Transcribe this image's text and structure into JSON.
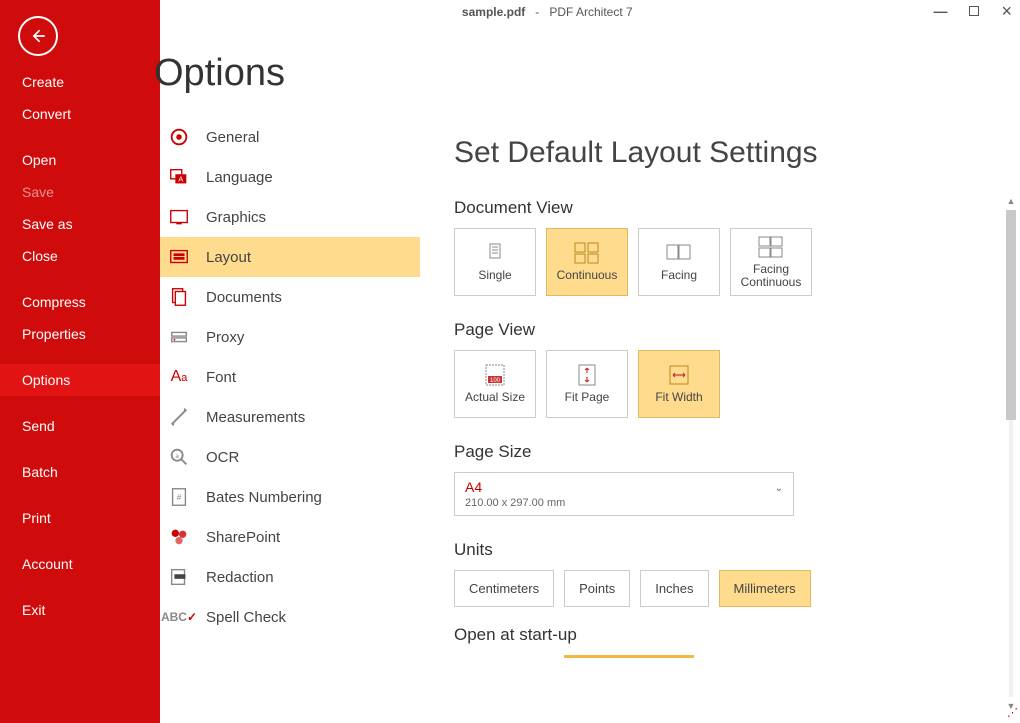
{
  "title": {
    "doc": "sample.pdf",
    "sep": "-",
    "app": "PDF Architect 7"
  },
  "sidebar": {
    "groups": [
      [
        "Create",
        "Convert"
      ],
      [
        "Open",
        "Save",
        "Save as",
        "Close"
      ],
      [
        "Compress",
        "Properties"
      ],
      [
        "Options"
      ],
      [
        "Send"
      ],
      [
        "Batch"
      ],
      [
        "Print"
      ],
      [
        "Account"
      ],
      [
        "Exit"
      ]
    ],
    "disabled": [
      "Save"
    ],
    "active": "Options"
  },
  "page_title": "Options",
  "categories": [
    {
      "id": "general",
      "label": "General"
    },
    {
      "id": "language",
      "label": "Language"
    },
    {
      "id": "graphics",
      "label": "Graphics"
    },
    {
      "id": "layout",
      "label": "Layout",
      "selected": true
    },
    {
      "id": "documents",
      "label": "Documents"
    },
    {
      "id": "proxy",
      "label": "Proxy"
    },
    {
      "id": "font",
      "label": "Font"
    },
    {
      "id": "measurements",
      "label": "Measurements"
    },
    {
      "id": "ocr",
      "label": "OCR"
    },
    {
      "id": "bates",
      "label": "Bates Numbering"
    },
    {
      "id": "sharepoint",
      "label": "SharePoint"
    },
    {
      "id": "redaction",
      "label": "Redaction"
    },
    {
      "id": "spellcheck",
      "label": "Spell Check"
    }
  ],
  "panel": {
    "heading": "Set Default Layout Settings",
    "doc_view": {
      "label": "Document View",
      "options": [
        "Single",
        "Continuous",
        "Facing",
        "Facing Continuous"
      ],
      "selected": "Continuous"
    },
    "page_view": {
      "label": "Page View",
      "options": [
        "Actual Size",
        "Fit Page",
        "Fit Width"
      ],
      "selected": "Fit Width"
    },
    "page_size": {
      "label": "Page Size",
      "value": "A4",
      "detail": "210.00 x 297.00 mm"
    },
    "units": {
      "label": "Units",
      "options": [
        "Centimeters",
        "Points",
        "Inches",
        "Millimeters"
      ],
      "selected": "Millimeters"
    },
    "startup": {
      "label": "Open at start-up"
    }
  }
}
